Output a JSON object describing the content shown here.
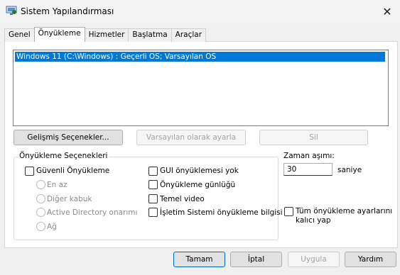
{
  "window": {
    "title": "Sistem Yapılandırması",
    "close_glyph": "✕"
  },
  "tabs": [
    {
      "label": "Genel"
    },
    {
      "label": "Önyükleme",
      "active": true
    },
    {
      "label": "Hizmetler"
    },
    {
      "label": "Başlatma"
    },
    {
      "label": "Araçlar"
    }
  ],
  "boot_list": {
    "items": [
      "Windows 11 (C:\\Windows) : Geçerli OS; Varsayılan OS"
    ]
  },
  "buttons": {
    "advanced": "Gelişmiş Seçenekler...",
    "set_default": "Varsayılan olarak ayarla",
    "delete": "Sil"
  },
  "boot_options": {
    "legend": "Önyükleme Seçenekleri",
    "safe_boot": "Güvenli Önyükleme",
    "minimal": "En az",
    "alternate_shell": "Diğer kabuk",
    "ad_repair": "Active Directory onarımı",
    "network": "Ağ",
    "no_gui_boot": "GUI önyüklemesi yok",
    "boot_log": "Önyükleme günlüğü",
    "base_video": "Temel video",
    "os_boot_info": "İşletim Sistemi önyükleme bilgisi"
  },
  "timeout": {
    "label": "Zaman aşımı:",
    "value": "30",
    "unit": "saniye"
  },
  "make_permanent": {
    "line1": "Tüm önyükleme ayarlarını",
    "line2": "kalıcı yap"
  },
  "footer": {
    "ok": "Tamam",
    "cancel": "İptal",
    "apply": "Uygula",
    "help": "Yardım"
  }
}
